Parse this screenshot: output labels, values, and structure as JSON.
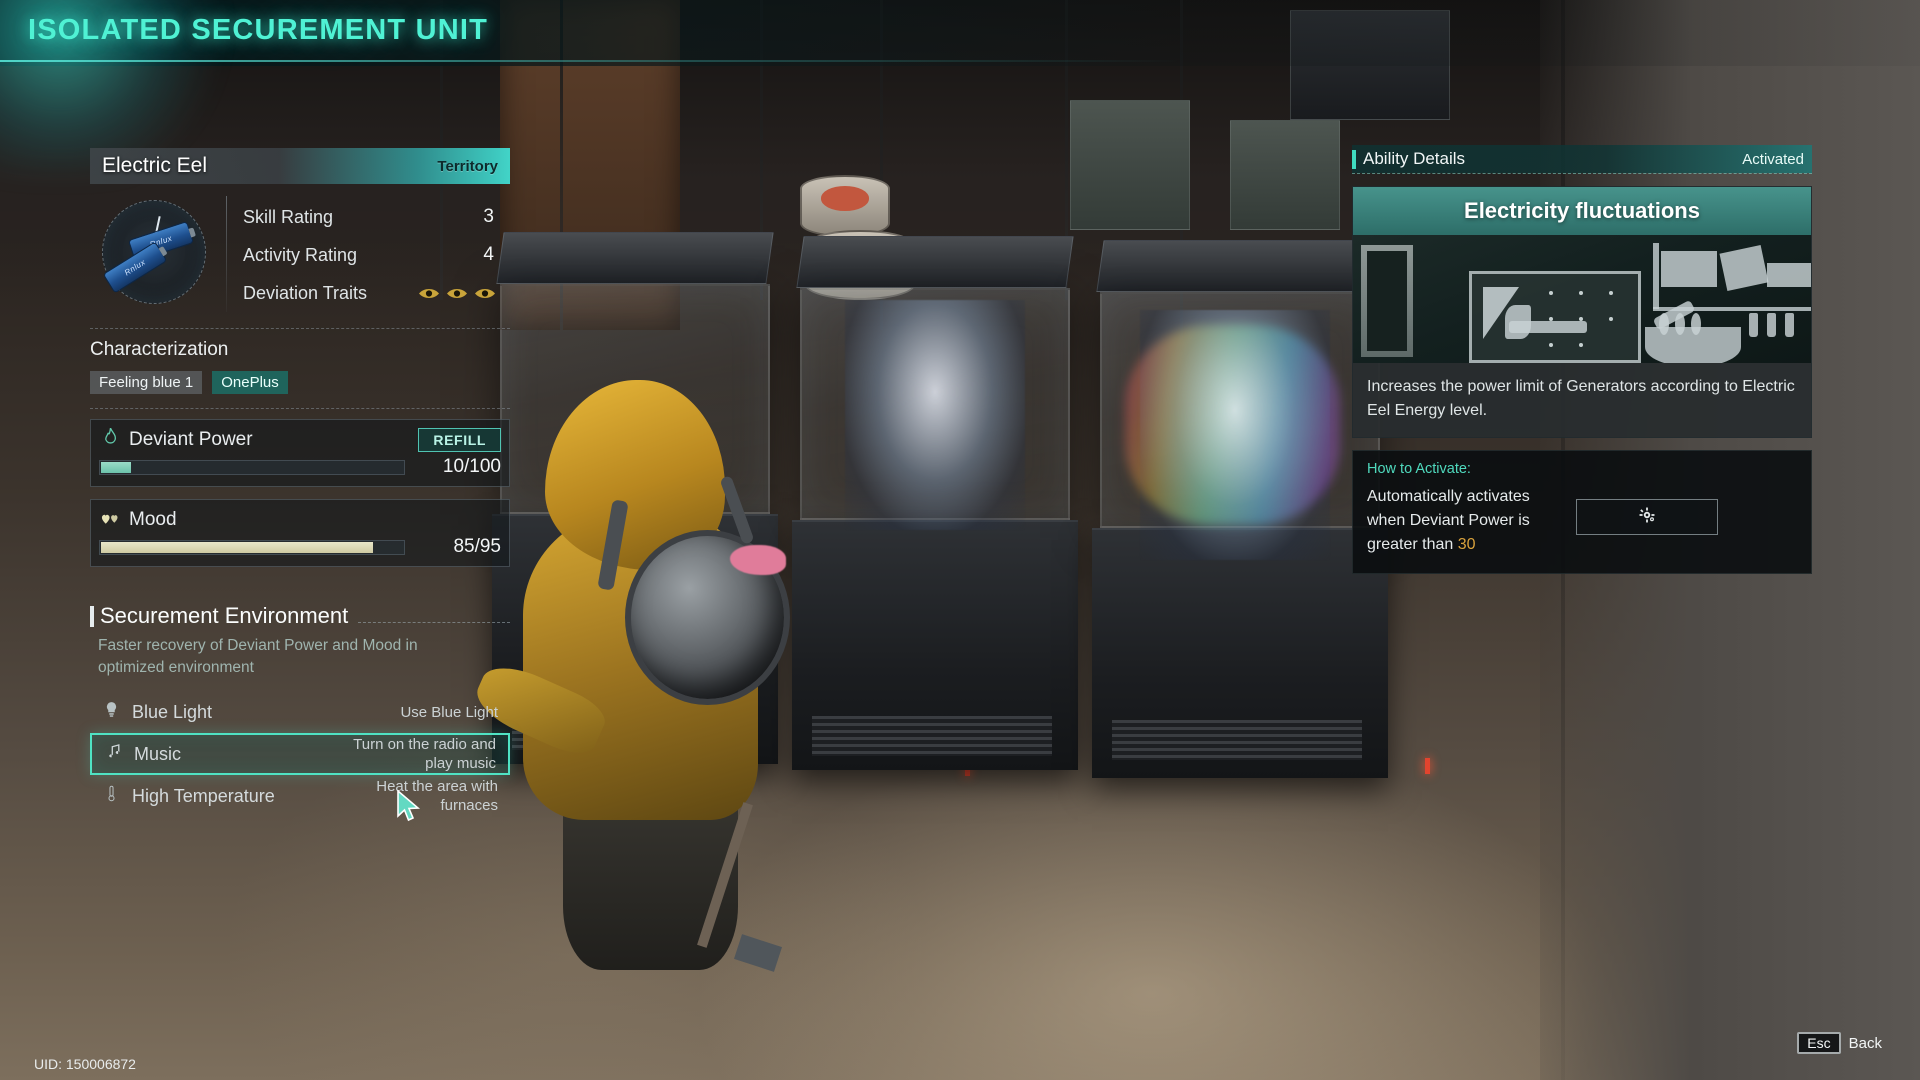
{
  "header": {
    "title": "ISOLATED SECUREMENT UNIT"
  },
  "creature": {
    "name": "Electric Eel",
    "tag": "Territory",
    "portrait_icon": "battery-icon",
    "stats": [
      {
        "label": "Skill Rating",
        "value": "3"
      },
      {
        "label": "Activity Rating",
        "value": "4"
      }
    ],
    "traits_label": "Deviation Traits",
    "traits_icon_count": 3,
    "traits_icon": "eye-icon"
  },
  "characterization": {
    "label": "Characterization",
    "tags": [
      {
        "text": "Feeling blue 1",
        "style": "gray"
      },
      {
        "text": "OnePlus",
        "style": "teal"
      }
    ]
  },
  "meters": [
    {
      "icon": "flame-icon",
      "name": "Deviant Power",
      "action_label": "REFILL",
      "current": 10,
      "max": 100,
      "display": "10/100",
      "fill_color": "#7fceb4"
    },
    {
      "icon": "hearts-icon",
      "name": "Mood",
      "action_label": "",
      "current": 85,
      "max": 95,
      "display": "85/95",
      "fill_color": "#d8d4ad"
    }
  ],
  "securement_environment": {
    "title": "Securement Environment",
    "description": "Faster recovery of Deviant Power and Mood in optimized environment",
    "rows": [
      {
        "icon": "bulb-icon",
        "name": "Blue Light",
        "action": "Use Blue Light",
        "selected": false
      },
      {
        "icon": "music-note-icon",
        "name": "Music",
        "action": "Turn on the radio and play music",
        "selected": true
      },
      {
        "icon": "thermometer-icon",
        "name": "High Temperature",
        "action": "Heat the area with furnaces",
        "selected": false
      }
    ]
  },
  "ability_details": {
    "panel_title": "Ability Details",
    "status": "Activated",
    "ability_name": "Electricity fluctuations",
    "description": "Increases the power limit of Generators according to Electric Eel Energy level.",
    "how_to_activate_label": "How to Activate:",
    "how_to_activate_text_prefix": "Automatically activates when Deviant Power is greater than ",
    "how_to_activate_threshold": "30",
    "config_button_icon": "gear-icon",
    "config_button_label": ""
  },
  "footer": {
    "uid": "UID: 150006872",
    "key": "Esc",
    "key_label": "Back"
  },
  "colors": {
    "accent_teal": "#4fe3c4",
    "title_glow": "#4ff2d4",
    "amber": "#d9a23c",
    "tag_teal": "#1c6e66"
  }
}
